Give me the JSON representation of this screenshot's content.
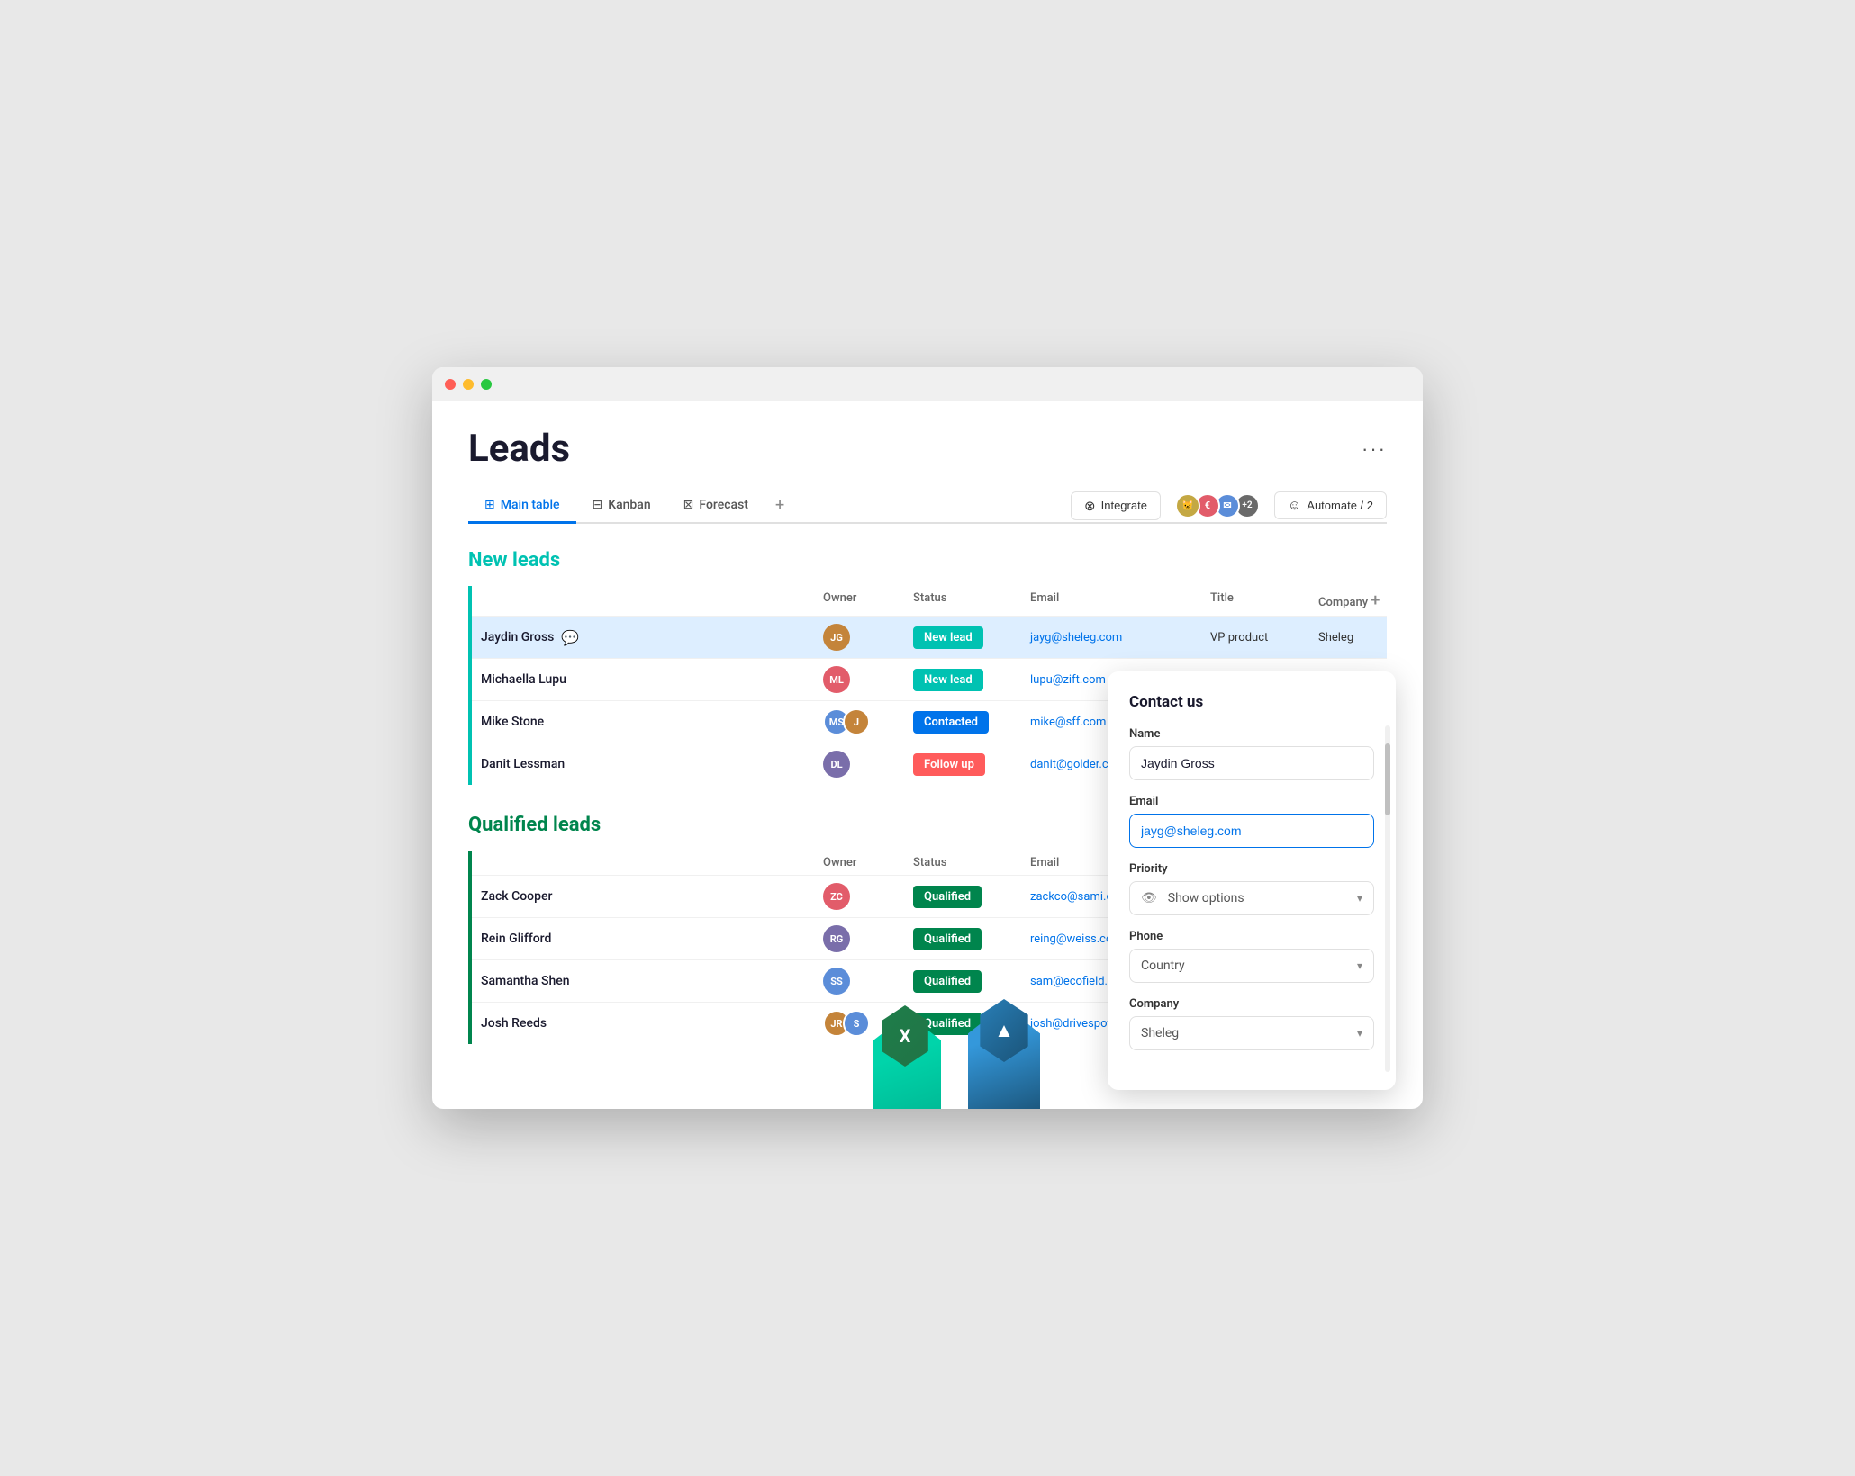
{
  "window": {
    "title": "Leads"
  },
  "header": {
    "title": "Leads",
    "more_label": "···"
  },
  "tabs": [
    {
      "id": "main-table",
      "label": "Main table",
      "icon": "⊞",
      "active": true
    },
    {
      "id": "kanban",
      "label": "Kanban",
      "icon": "⊟",
      "active": false
    },
    {
      "id": "forecast",
      "label": "Forecast",
      "icon": "⊠",
      "active": false
    }
  ],
  "tab_add": "+",
  "actions": {
    "integrate": "Integrate",
    "automate": "Automate / 2",
    "avatar_count": "+2"
  },
  "new_leads": {
    "title": "New leads",
    "columns": [
      "",
      "Owner",
      "Status",
      "Email",
      "Title",
      "Company"
    ],
    "rows": [
      {
        "name": "Jaydin Gross",
        "owner_initials": "JG",
        "owner_color": "#c4843a",
        "status": "New lead",
        "status_class": "status-new",
        "email": "jayg@sheleg.com",
        "title": "VP product",
        "company": "Sheleg",
        "highlighted": true,
        "has_chat": true
      },
      {
        "name": "Michaella Lupu",
        "owner_initials": "ML",
        "owner_color": "#e25c6a",
        "status": "New lead",
        "status_class": "status-new",
        "email": "lupu@zift.com",
        "title": "",
        "company": "",
        "highlighted": false,
        "has_chat": false
      },
      {
        "name": "Mike Stone",
        "owner_initials": "MS",
        "owner_color": "#5b8dd9",
        "status": "Contacted",
        "status_class": "status-contacted",
        "email": "mike@sff.com",
        "title": "",
        "company": "",
        "highlighted": false,
        "has_chat": false,
        "multi_owner": true
      },
      {
        "name": "Danit Lessman",
        "owner_initials": "DL",
        "owner_color": "#7a6eaa",
        "status": "Follow up",
        "status_class": "status-followup",
        "email": "danit@golder.com",
        "title": "",
        "company": "",
        "highlighted": false,
        "has_chat": false
      }
    ]
  },
  "qualified_leads": {
    "title": "Qualified leads",
    "columns": [
      "",
      "Owner",
      "Status",
      "Email"
    ],
    "rows": [
      {
        "name": "Zack Cooper",
        "owner_initials": "ZC",
        "owner_color": "#e25c6a",
        "status": "Qualified",
        "status_class": "status-qualified",
        "email": "zackco@sami.com",
        "highlighted": false,
        "has_chat": false
      },
      {
        "name": "Rein Glifford",
        "owner_initials": "RG",
        "owner_color": "#7a6eaa",
        "status": "Qualified",
        "status_class": "status-qualified",
        "email": "reing@weiss.com",
        "highlighted": false,
        "has_chat": false
      },
      {
        "name": "Samantha Shen",
        "owner_initials": "SS",
        "owner_color": "#5b8dd9",
        "status": "Qualified",
        "status_class": "status-qualified",
        "email": "sam@ecofield.com",
        "highlighted": false,
        "has_chat": false
      },
      {
        "name": "Josh Reeds",
        "owner_initials": "JR",
        "owner_color": "#c4843a",
        "status": "Qualified",
        "status_class": "status-qualified",
        "email": "josh@drivespot.io",
        "highlighted": false,
        "has_chat": false,
        "multi_owner": true
      }
    ]
  },
  "contact_panel": {
    "title": "Contact us",
    "name_label": "Name",
    "name_value": "Jaydin Gross",
    "email_label": "Email",
    "email_value": "jayg@sheleg.com",
    "priority_label": "Priority",
    "priority_value": "Show options",
    "phone_label": "Phone",
    "phone_value": "Country",
    "company_label": "Company",
    "company_value": "Sheleg"
  }
}
